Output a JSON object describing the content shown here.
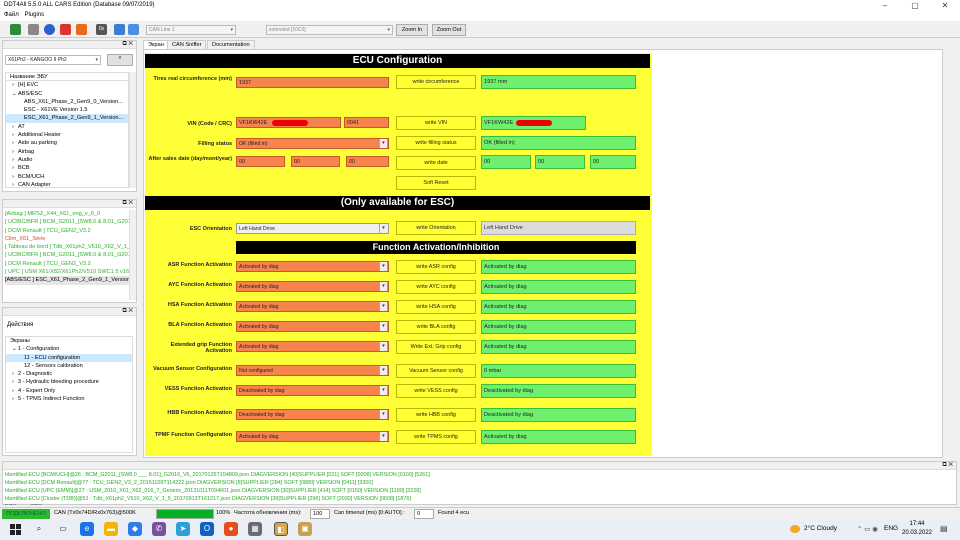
{
  "window": {
    "title": "DDT4All 5.5.0 ALL CARS Edition (Database 09/07/2019)"
  },
  "menu": [
    "Файл",
    "Plugins"
  ],
  "toolbar": {
    "can_line": "CAN Line 1",
    "session": "extended [10C0]",
    "zoom_in": "Zoom In",
    "zoom_out": "Zoom Out"
  },
  "ecu_panel": {
    "vehicle": "X61Ph2 - KANGOO II Ph2",
    "header": "Название ЭБУ",
    "tree": [
      {
        "label": "[H] EVC",
        "indent": 1,
        "sym": "›"
      },
      {
        "label": "ABS/ESC",
        "indent": 1,
        "sym": "⌄"
      },
      {
        "label": "ABS_X61_Phase_2_Gen9_0_Version...",
        "indent": 2,
        "sym": ""
      },
      {
        "label": "ESC - X61VE Version 1.5",
        "indent": 2,
        "sym": ""
      },
      {
        "label": "ESC_X61_Phase_2_Gen9_1_Version...",
        "indent": 2,
        "sym": "",
        "selected": true
      },
      {
        "label": "AT",
        "indent": 1,
        "sym": "›"
      },
      {
        "label": "Additional Heater",
        "indent": 1,
        "sym": "›"
      },
      {
        "label": "Aide au parking",
        "indent": 1,
        "sym": "›"
      },
      {
        "label": "Airbag",
        "indent": 1,
        "sym": "›"
      },
      {
        "label": "Audio",
        "indent": 1,
        "sym": "›"
      },
      {
        "label": "BCB",
        "indent": 1,
        "sym": "›"
      },
      {
        "label": "BCM/UCH",
        "indent": 1,
        "sym": "›"
      },
      {
        "label": "CAN Adapter",
        "indent": 1,
        "sym": "›"
      }
    ]
  },
  "found_list": [
    "[Airbag ] MRSZ_X44_X61_eng_v_6_0",
    "[ UCBIC/BFR ] BCM_G2011_[SW8.0 & 8.01_G201",
    "[ DCM Renault ] TCU_GEN2_V3.2",
    "Clim_X61_Série",
    "[ Tableau de bord ] Tdb_X61ph2_V510_X62_V_1_5",
    "[ UCBIC/BFR ] BCM_G2011_[SW8.0 & 8.01_G201",
    "[ DCM Renault ] TCU_GEN2_V3.2",
    "[ UPC ] USM X61/X82/X61Ph2/V510 SWC1 5 v16",
    "[ABS/ESC ] ESC_X61_Phase_2_Gen9_1_Version_"
  ],
  "screens_panel": {
    "actions_label": "Действия",
    "screens_label": "Экраны",
    "tree": [
      {
        "label": "1 - Configuration",
        "indent": 1,
        "sym": "⌄"
      },
      {
        "label": "11 - ECU configuration",
        "indent": 2,
        "sym": "",
        "selected": true
      },
      {
        "label": "12 - Sensors calibration",
        "indent": 2,
        "sym": ""
      },
      {
        "label": "2 - Diagnostic",
        "indent": 1,
        "sym": "›"
      },
      {
        "label": "3 - Hydraulic bleeding procedure",
        "indent": 1,
        "sym": "›"
      },
      {
        "label": "4 - Expert Only",
        "indent": 1,
        "sym": "›"
      },
      {
        "label": "5 - TPMS Indirect Function",
        "indent": 1,
        "sym": "›"
      }
    ]
  },
  "tabs": [
    "Экран",
    "CAN Sniffer",
    "Documentation"
  ],
  "screen": {
    "title": "ECU Configuration",
    "tyre": {
      "label": "Tires real circumference (mm)",
      "value": "1937",
      "button": "write circumference",
      "status": "1937 mm"
    },
    "vin": {
      "label": "VIN (Code / CRC)",
      "value": "VF1KW42E",
      "crc": "0041",
      "button": "write VIN",
      "status": "VF1KW42E"
    },
    "filling": {
      "label": "Filling status",
      "value": "OK (filled in)",
      "button": "write filling status",
      "status": "OK (filled in)"
    },
    "date": {
      "label": "After sales date (day/mont/year)",
      "d": "00",
      "m": "00",
      "y": "00",
      "button": "write date",
      "sd": "00",
      "sm": "00",
      "sy": "00"
    },
    "soft_reset": "Soft Reset",
    "esc_title": "(Only available for ESC)",
    "orientation": {
      "label": "ESC Orientation",
      "value": "Left Hand Drive",
      "button": "write Orientation",
      "status": "Left Hand Drive"
    },
    "func_title": "Function Activation/Inhibition",
    "functions": [
      {
        "label": "ASR Function Activation",
        "value": "Activated by diag",
        "button": "write ASR config",
        "status": "Activated by diag"
      },
      {
        "label": "AYC Function Activation",
        "value": "Activated by diag",
        "button": "write AYC config",
        "status": "Activated by diag"
      },
      {
        "label": "HSA Function Activation",
        "value": "Activated by diag",
        "button": "write HSA config",
        "status": "Activated by diag"
      },
      {
        "label": "BLA Function Activation",
        "value": "Activated by diag",
        "button": "write BLA config",
        "status": "Activated by diag"
      },
      {
        "label": "Extended grip Function Activation",
        "value": "Activated by diag",
        "button": "Write Ext. Grip config",
        "status": "Activated by diag"
      },
      {
        "label": "Vacuum Sensor Configuration",
        "value": "Not configured",
        "button": "Vacuum Sensor config",
        "status": "0 mbar"
      },
      {
        "label": "VESS Function Activation",
        "value": "Deactivated by diag",
        "button": "write VESS config",
        "status": "Deactivated by diag"
      },
      {
        "label": "HBB Function Activation",
        "value": "Deactivated by diag",
        "button": "write HBB config",
        "status": "Deactivated by diag"
      },
      {
        "label": "TPMF Function Configuration",
        "value": "Activated by diag",
        "button": "write TPMS config",
        "status": "Activated by diag"
      }
    ]
  },
  "log": [
    "Identified ECU [BCM/UCH]@26 : BCM_G2011_[SW8.0 ___ 8.01]_G2016_V6_20170126T154809.json DIAGVERSION [40]SUPPLIER [021] SOFT [0008] VERSION [0100] [5261]",
    "Identified ECU [DCM Renault]@77 : TCU_GEN2_V3_2_20151109T114222.json DIAGVERSION [8]SUPPLIER [284] SOFT [0880] VERSION [0411] [3300]",
    "Identified ECU [UPC (EMM)]@27 : USM_2010_X61_X62_016_7_Generic_20131011T094601.json DIAGVERSION [30]SUPPLIER [414] SOFT [0150] VERSION [1190] [3228]",
    "Identified ECU [Cluster (TDB)]@51 : Tdb_X61ph2_V510_X62_V_1_5_20170913T161217.json DIAGVERSION [38]SUPPLIER [296] SOFT [2030] VERSION [0608] [1876]",
    "ECU uses SDS"
  ],
  "statusbar": {
    "connected": "ПОДКЛЮЧЕНО",
    "adapter": "CAN (Tx0x74D/Rx0x763)@500K",
    "progress_pct": 100,
    "progress_text": "100%",
    "refresh_label": "Частота обновления (ms):",
    "refresh_value": "100",
    "timeout_label": "Can timeout (ms) [0:AUTO] :",
    "timeout_value": "0",
    "found": "Found 4 ecu"
  },
  "taskbar": {
    "weather": "2°C  Cloudy",
    "lang": "ENG",
    "time": "17:44",
    "date": "20.03.2022"
  }
}
